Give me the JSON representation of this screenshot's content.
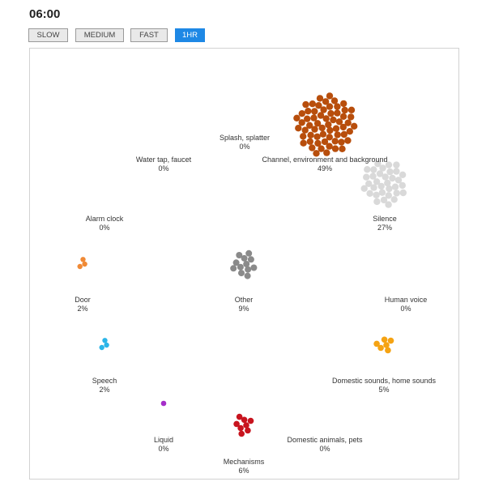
{
  "header": {
    "time": "06:00"
  },
  "speed_controls": [
    {
      "label": "SLOW",
      "active": false
    },
    {
      "label": "MEDIUM",
      "active": false
    },
    {
      "label": "FAST",
      "active": false
    },
    {
      "label": "1HR",
      "active": true
    }
  ],
  "categories": [
    {
      "name": "Splash, splatter",
      "percent": "0%",
      "count": 0,
      "color": "#b84e0c"
    },
    {
      "name": "Water tap, faucet",
      "percent": "0%",
      "count": 0,
      "color": "#b84e0c"
    },
    {
      "name": "Channel, environment and background",
      "percent": "49%",
      "count": 62,
      "color": "#b84e0c"
    },
    {
      "name": "Alarm clock",
      "percent": "0%",
      "count": 0,
      "color": "#999999"
    },
    {
      "name": "Silence",
      "percent": "27%",
      "count": 34,
      "color": "#d9d9d9"
    },
    {
      "name": "Door",
      "percent": "2%",
      "count": 3,
      "color": "#f08a36"
    },
    {
      "name": "Other",
      "percent": "9%",
      "count": 12,
      "color": "#8a8a8a"
    },
    {
      "name": "Human voice",
      "percent": "0%",
      "count": 0,
      "color": "#999999"
    },
    {
      "name": "Speech",
      "percent": "2%",
      "count": 3,
      "color": "#2cb5e8"
    },
    {
      "name": "Domestic sounds, home sounds",
      "percent": "5%",
      "count": 6,
      "color": "#f5a313"
    },
    {
      "name": "Liquid",
      "percent": "0%",
      "count": 1,
      "color": "#a52ec9"
    },
    {
      "name": "Domestic animals, pets",
      "percent": "0%",
      "count": 0,
      "color": "#999999"
    },
    {
      "name": "Mechanisms",
      "percent": "6%",
      "count": 8,
      "color": "#c8141e"
    }
  ]
}
